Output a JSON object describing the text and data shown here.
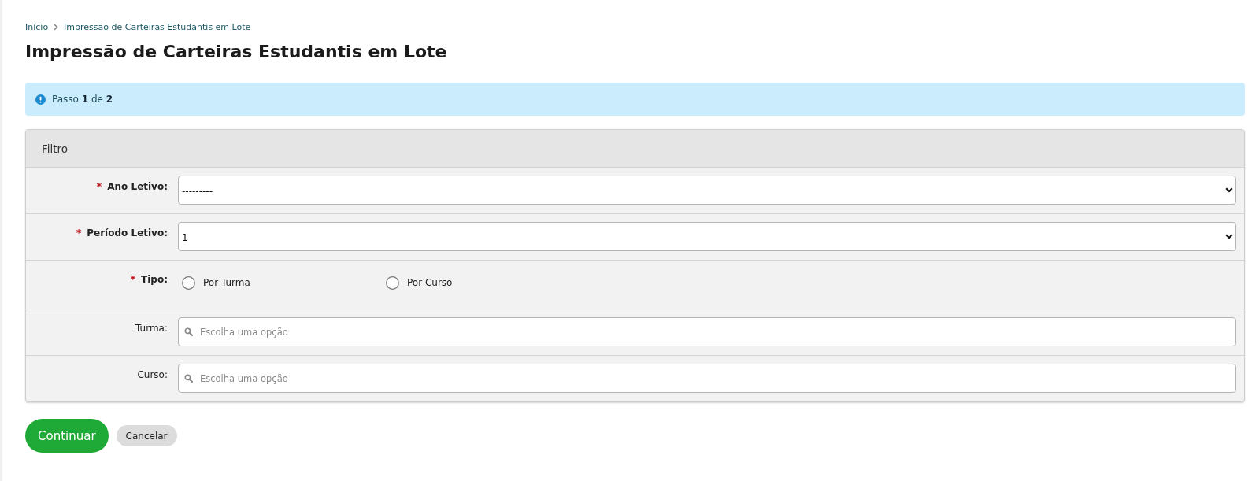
{
  "breadcrumb": [
    {
      "label": "Início"
    },
    {
      "label": "Impressão de Carteiras Estudantis em Lote"
    }
  ],
  "title": "Impressão de Carteiras Estudantis em Lote",
  "alert": {
    "text": "Passo **1** de **2**"
  },
  "panel": {
    "title": "Filtro",
    "fields": [
      {
        "kind": "select",
        "marker": "*",
        "label": "Ano Letivo:",
        "value": "---------"
      },
      {
        "kind": "select",
        "marker": "*",
        "label": "Período Letivo:",
        "value": "1"
      },
      {
        "kind": "radio",
        "marker": "*",
        "label": "Tipo:",
        "options": [
          {
            "label": "Por Turma",
            "selected": false
          },
          {
            "label": "Por Curso",
            "selected": false
          }
        ]
      },
      {
        "kind": "search",
        "label": "Turma:",
        "placeholder": "Escolha uma opção"
      },
      {
        "kind": "search",
        "label": "Curso:",
        "placeholder": "Escolha uma opção"
      }
    ]
  },
  "buttons": [
    {
      "label": "Continuar",
      "kind": "primary"
    },
    {
      "label": "Cancelar",
      "kind": "secondary"
    }
  ]
}
